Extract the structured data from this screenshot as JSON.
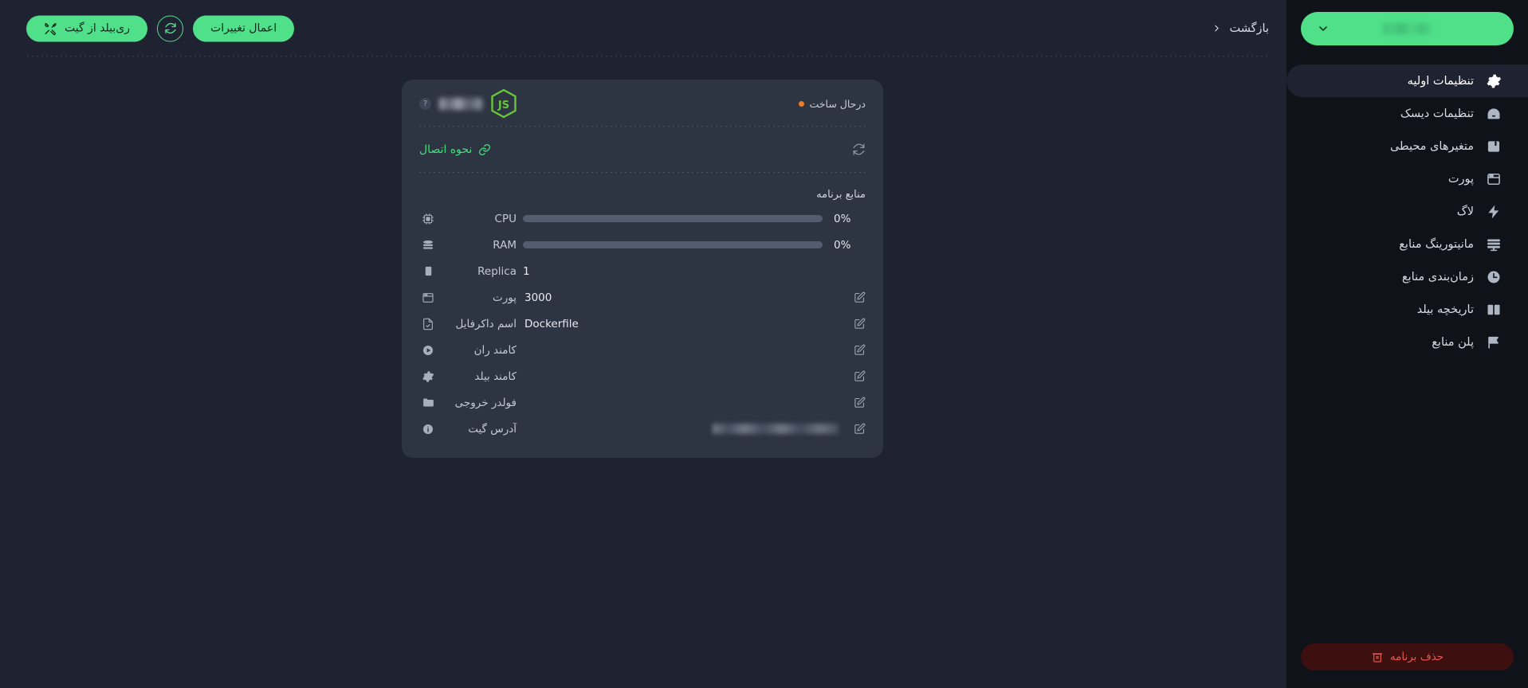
{
  "topbar": {
    "back_label": "بازگشت",
    "back_icon": "chevron-left-icon",
    "apply_changes_label": "اعمال تغییرات",
    "refresh_icon": "refresh-icon",
    "rebuild_label": "ری‌بیلد از گیت",
    "rebuild_icon": "tools-icon"
  },
  "sidebar": {
    "project_pill": {
      "name": "",
      "chevron_icon": "chevron-down-icon",
      "accent": "#4fe089"
    },
    "items": [
      {
        "label": "تنظیمات اولیه",
        "icon": "gear-icon",
        "active": true
      },
      {
        "label": "تنظیمات دیسک",
        "icon": "hard-drive-icon",
        "active": false
      },
      {
        "label": "متغیرهای محیطی",
        "icon": "env-variables-icon",
        "active": false
      },
      {
        "label": "پورت",
        "icon": "window-icon",
        "active": false
      },
      {
        "label": "لاگ",
        "icon": "bolt-icon",
        "active": false
      },
      {
        "label": "مانیتورینگ منابع",
        "icon": "monitor-icon",
        "active": false
      },
      {
        "label": "زمان‌بندی منابع",
        "icon": "clock-icon",
        "active": false
      },
      {
        "label": "تاریخچه بیلد",
        "icon": "book-icon",
        "active": false
      },
      {
        "label": "پلن منابع",
        "icon": "flag-icon",
        "active": false
      }
    ],
    "delete_button": {
      "label": "حذف برنامه",
      "icon": "trash-icon",
      "color": "#e8564f",
      "background": "#3d0f0f"
    }
  },
  "card": {
    "app_logo_icon": "nodejs-icon",
    "app_name": "",
    "help_icon": "question-mark-icon",
    "status": {
      "label": "درحال ساخت",
      "dot_color": "#f07c1f"
    },
    "connection": {
      "label": "نحوه اتصال",
      "icon": "link-icon",
      "color": "#46dd80",
      "refresh_icon": "refresh-icon"
    },
    "resources_title": "منابع برنامه",
    "rows": [
      {
        "icon": "cpu-icon",
        "label": "CPU",
        "type": "bar",
        "value": "0%",
        "percent": 0,
        "editable": false
      },
      {
        "icon": "ram-icon",
        "label": "RAM",
        "type": "bar",
        "value": "0%",
        "percent": 0,
        "editable": false
      },
      {
        "icon": "replica-icon",
        "label": "Replica",
        "type": "text",
        "value": "1",
        "editable": false
      },
      {
        "icon": "window-icon",
        "label": "پورت",
        "type": "text",
        "value": "3000",
        "editable": true
      },
      {
        "icon": "file-check-icon",
        "label": "اسم داکرفایل",
        "type": "text",
        "value": "Dockerfile",
        "editable": true
      },
      {
        "icon": "play-icon",
        "label": "کامند ران",
        "type": "text",
        "value": "",
        "editable": true
      },
      {
        "icon": "gear-icon",
        "label": "کامند بیلد",
        "type": "text",
        "value": "",
        "editable": true
      },
      {
        "icon": "folder-icon",
        "label": "فولدر خروجی",
        "type": "text",
        "value": "",
        "editable": true
      },
      {
        "icon": "info-icon",
        "label": "آدرس گیت",
        "type": "blur",
        "value": "",
        "editable": true
      }
    ],
    "edit_icon": "pencil-edit-icon"
  },
  "theme": {
    "background": "#1e2231",
    "sidebar_bg": "#0f1219",
    "card_bg": "#2d3442",
    "accent_green": "#4fe089",
    "bar_track": "#545d70"
  }
}
